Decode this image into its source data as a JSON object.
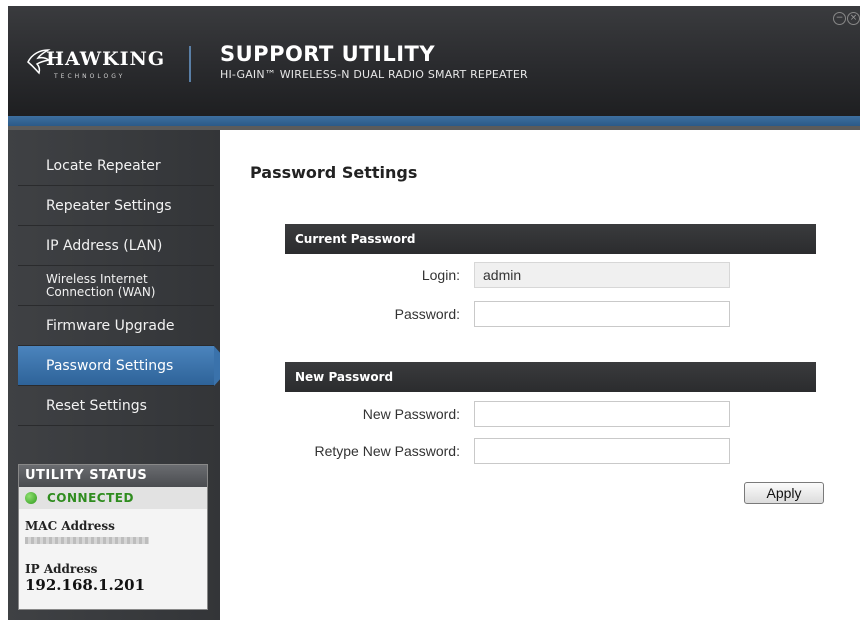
{
  "header": {
    "logo_text": "HAWKING",
    "logo_sub": "TECHNOLOGY",
    "title": "SUPPORT UTILITY",
    "subtitle": "HI-GAIN™ WIRELESS-N DUAL RADIO SMART REPEATER",
    "minimize_glyph": "−",
    "close_glyph": "×"
  },
  "sidebar": {
    "items": [
      {
        "label": "Locate Repeater"
      },
      {
        "label": "Repeater Settings"
      },
      {
        "label": "IP Address (LAN)"
      },
      {
        "label": "Wireless Internet Connection (WAN)"
      },
      {
        "label": "Firmware Upgrade"
      },
      {
        "label": "Password Settings",
        "active": true
      },
      {
        "label": "Reset Settings"
      }
    ],
    "status": {
      "heading": "UTILITY STATUS",
      "connection": "CONNECTED",
      "mac_label": "MAC Address",
      "ip_label": "IP Address",
      "ip_value": "192.168.1.201"
    }
  },
  "main": {
    "title": "Password Settings",
    "current_section": "Current Password",
    "login_label": "Login:",
    "login_value": "admin",
    "password_label": "Password:",
    "new_section": "New Password",
    "new_password_label": "New Password:",
    "retype_label": "Retype New Password:",
    "apply_label": "Apply"
  }
}
